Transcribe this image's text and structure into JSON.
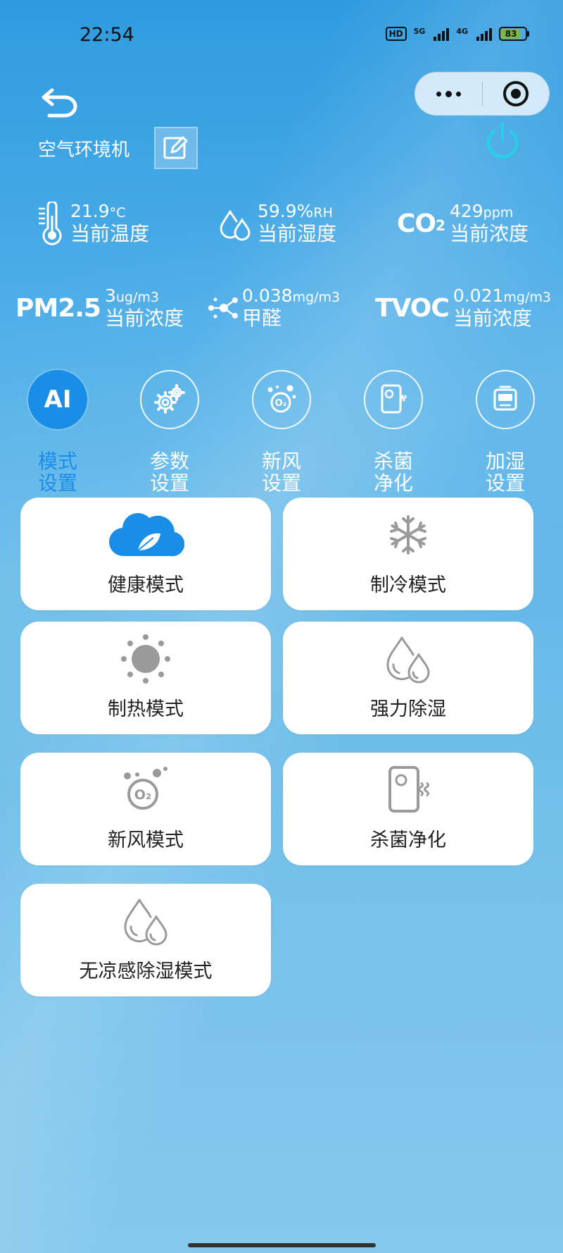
{
  "status_bar": {
    "time": "22:54",
    "hd": "HD",
    "net1": "5G",
    "net2": "4G",
    "battery": "83"
  },
  "header": {
    "device_name": "空气环境机"
  },
  "sensors": {
    "temperature": {
      "value": "21.9",
      "unit": "°C",
      "label": "当前温度"
    },
    "humidity": {
      "value": "59.9%",
      "unit": "RH",
      "label": "当前湿度"
    },
    "co2": {
      "abbr": "CO",
      "sub": "2",
      "value": "429",
      "unit": "ppm",
      "label": "当前浓度"
    },
    "pm25": {
      "abbr": "PM2.5",
      "value": "3",
      "unit": "ug/m3",
      "label": "当前浓度"
    },
    "formaldehyde": {
      "value": "0.038",
      "unit": "mg/m3",
      "label": "甲醛"
    },
    "tvoc": {
      "abbr": "TVOC",
      "value": "0.021",
      "unit": "mg/m3",
      "label": "当前浓度"
    }
  },
  "tabs": [
    {
      "label": "模式设置",
      "icon_text": "AI",
      "active": true
    },
    {
      "label": "参数设置",
      "active": false
    },
    {
      "label": "新风设置",
      "active": false
    },
    {
      "label": "杀菌净化",
      "active": false
    },
    {
      "label": "加湿设置",
      "active": false
    }
  ],
  "modes": [
    {
      "label": "健康模式",
      "icon": "cloud-leaf-icon"
    },
    {
      "label": "制冷模式",
      "icon": "snowflake-icon"
    },
    {
      "label": "制热模式",
      "icon": "sun-icon"
    },
    {
      "label": "强力除湿",
      "icon": "droplets-icon"
    },
    {
      "label": "新风模式",
      "icon": "oxygen-icon"
    },
    {
      "label": "杀菌净化",
      "icon": "sterilize-icon"
    },
    {
      "label": "无凉感除湿模式",
      "icon": "droplets-icon"
    }
  ],
  "colors": {
    "accent": "#1a8ee6",
    "icon_gray": "#9a9a9a"
  }
}
